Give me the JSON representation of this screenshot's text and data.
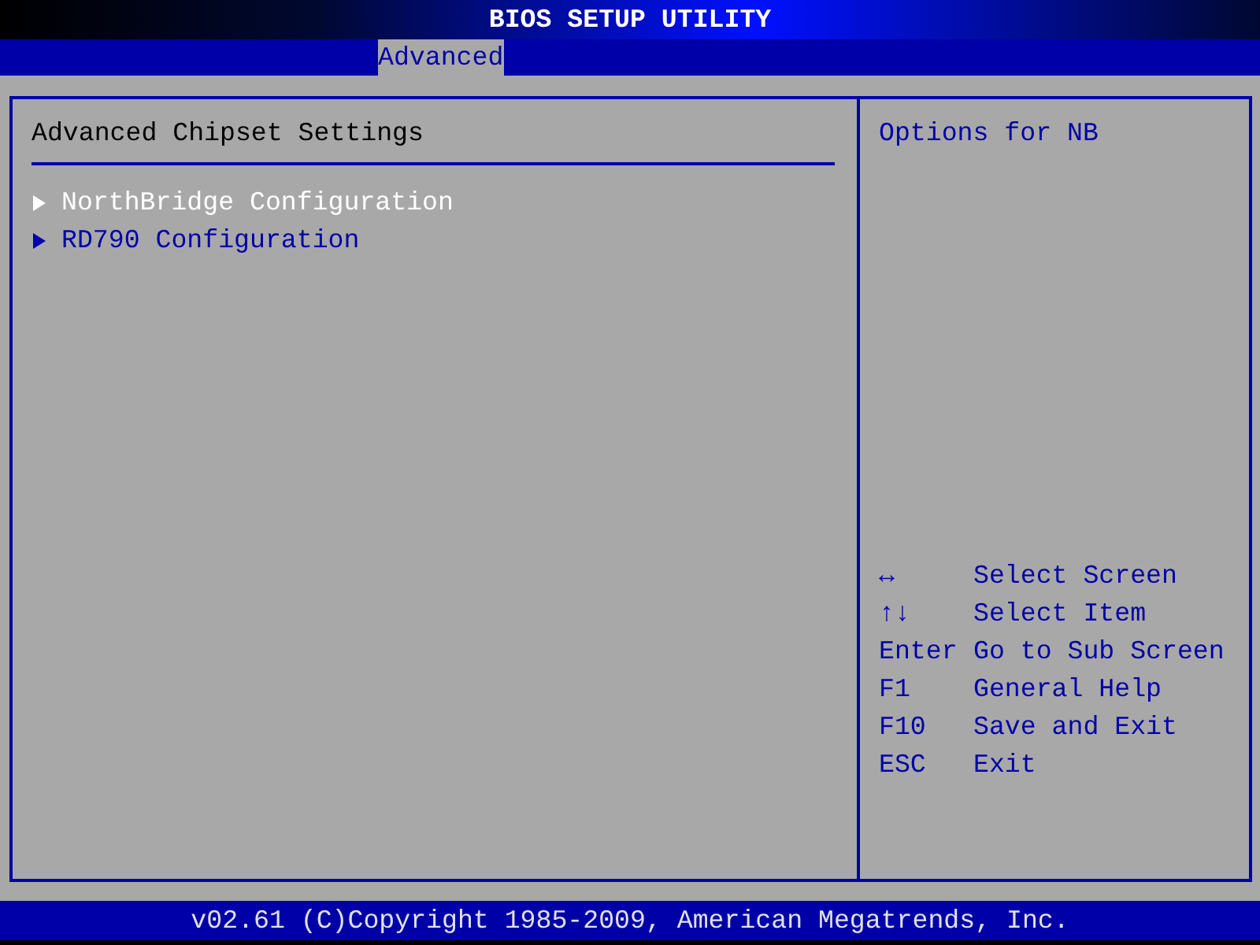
{
  "window": {
    "title": "BIOS SETUP UTILITY"
  },
  "tabs": [
    {
      "label": "Advanced",
      "selected": true
    }
  ],
  "panel": {
    "title": "Advanced Chipset Settings",
    "items": [
      {
        "label": "NorthBridge Configuration",
        "selected": true
      },
      {
        "label": "RD790 Configuration",
        "selected": false
      }
    ]
  },
  "help": {
    "text": "Options for NB",
    "keys": [
      {
        "key": "↔",
        "action": "Select Screen"
      },
      {
        "key": "↑↓",
        "action": "Select Item"
      },
      {
        "key": "Enter",
        "action": "Go to Sub Screen"
      },
      {
        "key": "F1",
        "action": "General Help"
      },
      {
        "key": "F10",
        "action": "Save and Exit"
      },
      {
        "key": "ESC",
        "action": "Exit"
      }
    ]
  },
  "status_bar": "v02.61 (C)Copyright 1985-2009, American Megatrends, Inc."
}
